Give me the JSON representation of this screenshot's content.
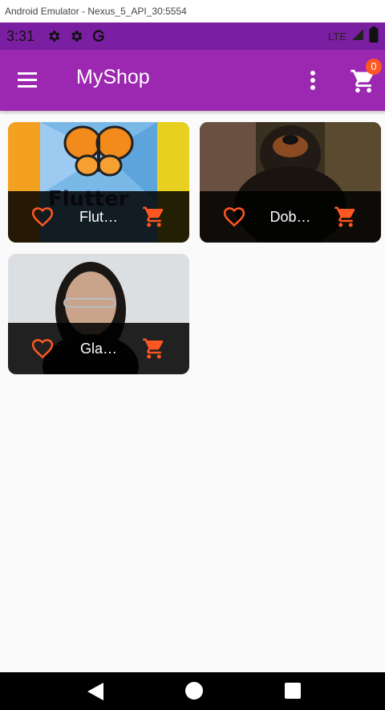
{
  "window": {
    "title": "Android Emulator - Nexus_5_API_30:5554"
  },
  "statusbar": {
    "time": "3:31",
    "network": "LTE",
    "icons": [
      "gear-icon",
      "gear-icon",
      "google-g-icon",
      "signal-icon",
      "battery-icon"
    ]
  },
  "appbar": {
    "title": "MyShop",
    "cart_count": "0",
    "icons": [
      "menu-icon",
      "more-vert-icon",
      "shopping-cart-icon"
    ]
  },
  "products": [
    {
      "title": "Flut…",
      "image": "flutter-book-cover-butterfly"
    },
    {
      "title": "Dob…",
      "image": "doberman-dog-photo"
    },
    {
      "title": "Gla…",
      "image": "woman-with-glasses-photo"
    }
  ],
  "colors": {
    "statusbar": "#7b1fa2",
    "appbar": "#9c27b0",
    "accent": "#ff5722",
    "background": "#fafafa"
  },
  "navbar": {
    "icons": [
      "back-icon",
      "home-icon",
      "recents-icon"
    ]
  }
}
